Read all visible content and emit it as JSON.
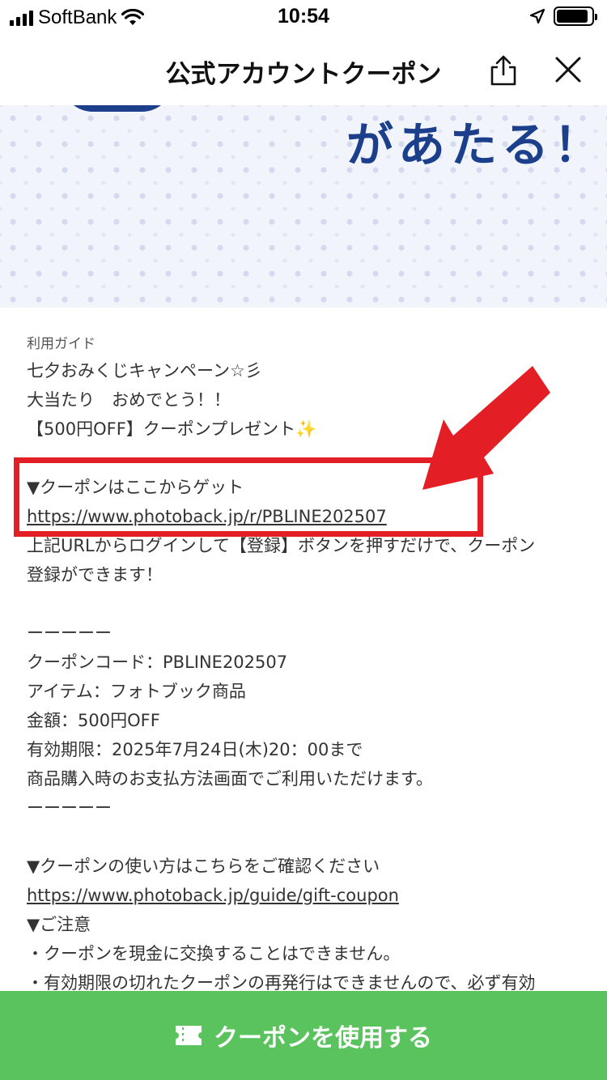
{
  "status_bar": {
    "carrier": "SoftBank",
    "time": "10:54",
    "battery_level": 0.9
  },
  "header": {
    "title": "公式アカウントクーポン",
    "share_icon": "share-icon",
    "close_icon": "close-icon"
  },
  "banner": {
    "text": "があたる！"
  },
  "guide": {
    "label": "利用ガイド",
    "lines": [
      "七夕おみくじキャンペーン☆彡",
      "大当たり　おめでとう！！",
      "【500円OFF】クーポンプレゼント",
      "",
      "▼クーポンはここからゲット",
      "https://www.photoback.jp/r/PBLINE202507",
      "上記URLからログインして【登録】ボタンを押すだけで、クーポン",
      "登録ができます！",
      "",
      "ーーーーー",
      "クーポンコード：PBLINE202507",
      "アイテム：フォトブック商品",
      "金額：500円OFF",
      "有効期限：2025年7月24日(木)20：00まで",
      "商品購入時のお支払方法画面でご利用いただけます。",
      "ーーーーー",
      "",
      "▼クーポンの使い方はこちらをご確認ください",
      "https://www.photoback.jp/guide/gift-coupon",
      "▼ご注意",
      "・クーポンを現金に交換することはできません。",
      "・有効期限の切れたクーポンの再発行はできませんので、必ず有効"
    ],
    "sparkle": "✨"
  },
  "footer": {
    "button_label": "クーポンを使用する",
    "button_color": "#5ac35e"
  },
  "colors": {
    "highlight": "#e31e24",
    "banner_text": "#1c3f8c"
  }
}
